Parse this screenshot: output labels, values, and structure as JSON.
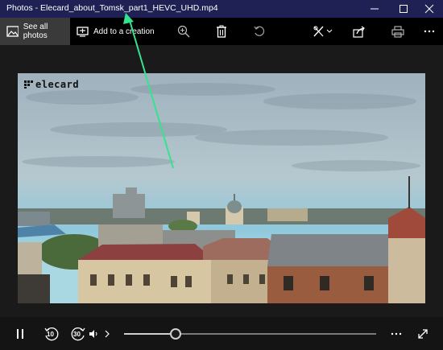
{
  "window": {
    "title": "Photos - Elecard_about_Tomsk_part1_HEVC_UHD.mp4"
  },
  "toolbar": {
    "see_all_label": "See all photos",
    "add_creation_label": "Add to a creation"
  },
  "video": {
    "watermark": "elecard"
  },
  "controls": {
    "rewind_label": "10",
    "forward_label": "30",
    "progress": 0.2
  },
  "colors": {
    "titlebar": "#1f2054",
    "annotation_arrow": "#35e38f"
  },
  "icons": {
    "see_all": "gallery-icon",
    "add_creation": "creation-icon",
    "zoom": "zoom-in-icon",
    "delete": "trash-icon",
    "rotate": "rotate-icon",
    "edit": "edit-create-icon",
    "share": "share-icon",
    "print": "print-icon",
    "more": "more-icon"
  }
}
